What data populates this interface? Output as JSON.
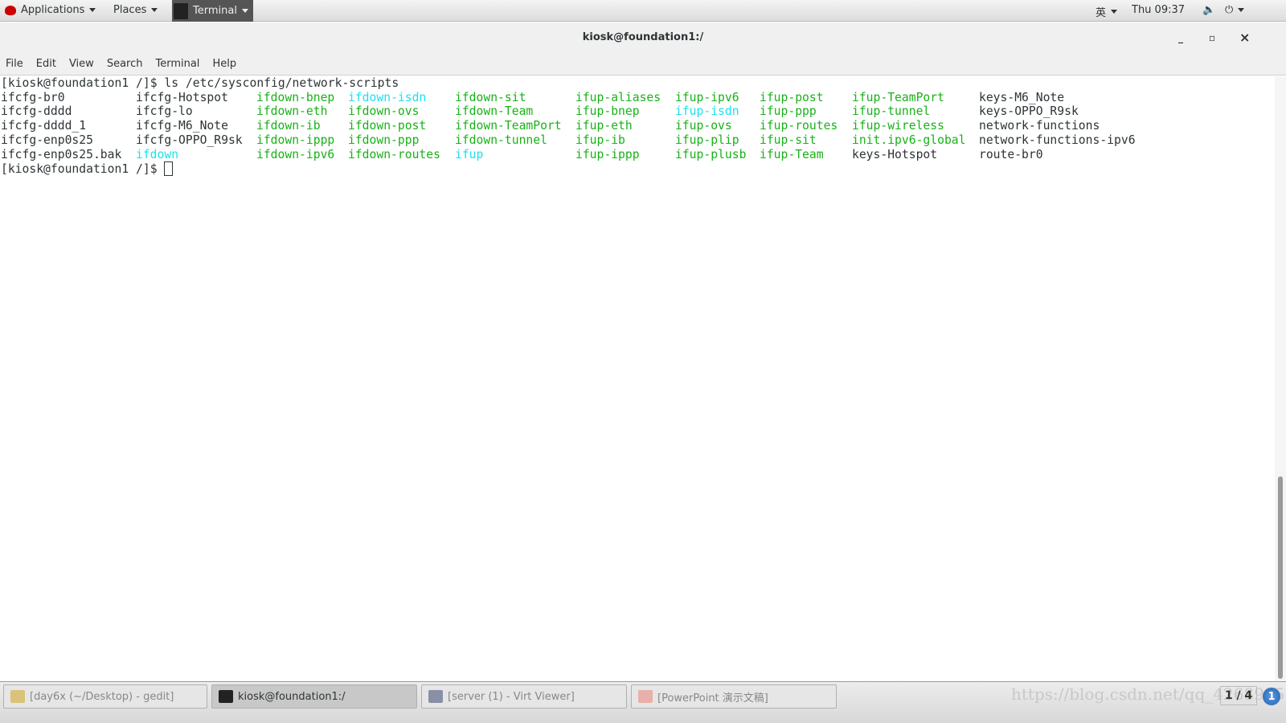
{
  "topbar": {
    "applications": "Applications",
    "places": "Places",
    "terminal": "Terminal",
    "input_method": "英",
    "clock": "Thu 09:37"
  },
  "window": {
    "title": "kiosk@foundation1:/",
    "minimize": "_",
    "maximize": "▫",
    "close": "×"
  },
  "menu": [
    "File",
    "Edit",
    "View",
    "Search",
    "Terminal",
    "Help"
  ],
  "terminal": {
    "prompt1": "[kiosk@foundation1 /]$ ls /etc/sysconfig/network-scripts",
    "prompt2": "[kiosk@foundation1 /]$ ",
    "colors": {
      "executable": "#18b218",
      "symlink": "#1ee0ee",
      "regular": "#2e3436"
    },
    "columns": [
      [
        [
          "ifcfg-br0",
          "r"
        ],
        [
          "ifcfg-dddd",
          "r"
        ],
        [
          "ifcfg-dddd_1",
          "r"
        ],
        [
          "ifcfg-enp0s25",
          "r"
        ],
        [
          "ifcfg-enp0s25.bak",
          "r"
        ]
      ],
      [
        [
          "ifcfg-Hotspot",
          "r"
        ],
        [
          "ifcfg-lo",
          "r"
        ],
        [
          "ifcfg-M6_Note",
          "r"
        ],
        [
          "ifcfg-OPPO_R9sk",
          "r"
        ],
        [
          "ifdown",
          "c"
        ]
      ],
      [
        [
          "ifdown-bnep",
          "g"
        ],
        [
          "ifdown-eth",
          "g"
        ],
        [
          "ifdown-ib",
          "g"
        ],
        [
          "ifdown-ippp",
          "g"
        ],
        [
          "ifdown-ipv6",
          "g"
        ]
      ],
      [
        [
          "ifdown-isdn",
          "c"
        ],
        [
          "ifdown-ovs",
          "g"
        ],
        [
          "ifdown-post",
          "g"
        ],
        [
          "ifdown-ppp",
          "g"
        ],
        [
          "ifdown-routes",
          "g"
        ]
      ],
      [
        [
          "ifdown-sit",
          "g"
        ],
        [
          "ifdown-Team",
          "g"
        ],
        [
          "ifdown-TeamPort",
          "g"
        ],
        [
          "ifdown-tunnel",
          "g"
        ],
        [
          "ifup",
          "c"
        ]
      ],
      [
        [
          "ifup-aliases",
          "g"
        ],
        [
          "ifup-bnep",
          "g"
        ],
        [
          "ifup-eth",
          "g"
        ],
        [
          "ifup-ib",
          "g"
        ],
        [
          "ifup-ippp",
          "g"
        ]
      ],
      [
        [
          "ifup-ipv6",
          "g"
        ],
        [
          "ifup-isdn",
          "c"
        ],
        [
          "ifup-ovs",
          "g"
        ],
        [
          "ifup-plip",
          "g"
        ],
        [
          "ifup-plusb",
          "g"
        ]
      ],
      [
        [
          "ifup-post",
          "g"
        ],
        [
          "ifup-ppp",
          "g"
        ],
        [
          "ifup-routes",
          "g"
        ],
        [
          "ifup-sit",
          "g"
        ],
        [
          "ifup-Team",
          "g"
        ]
      ],
      [
        [
          "ifup-TeamPort",
          "g"
        ],
        [
          "ifup-tunnel",
          "g"
        ],
        [
          "ifup-wireless",
          "g"
        ],
        [
          "init.ipv6-global",
          "g"
        ],
        [
          "keys-Hotspot",
          "r"
        ]
      ],
      [
        [
          "keys-M6_Note",
          "r"
        ],
        [
          "keys-OPPO_R9sk",
          "r"
        ],
        [
          "network-functions",
          "r"
        ],
        [
          "network-functions-ipv6",
          "r"
        ],
        [
          "route-br0",
          "r"
        ]
      ]
    ]
  },
  "taskbar": {
    "tasks": [
      "[day6x (~/Desktop) - gedit]",
      "kiosk@foundation1:/",
      "[server (1) - Virt Viewer]",
      "[PowerPoint 演示文稿]"
    ],
    "workspace": "1 / 4",
    "notifications": "1",
    "watermark": "https://blog.csdn.net/qq_4268945"
  }
}
